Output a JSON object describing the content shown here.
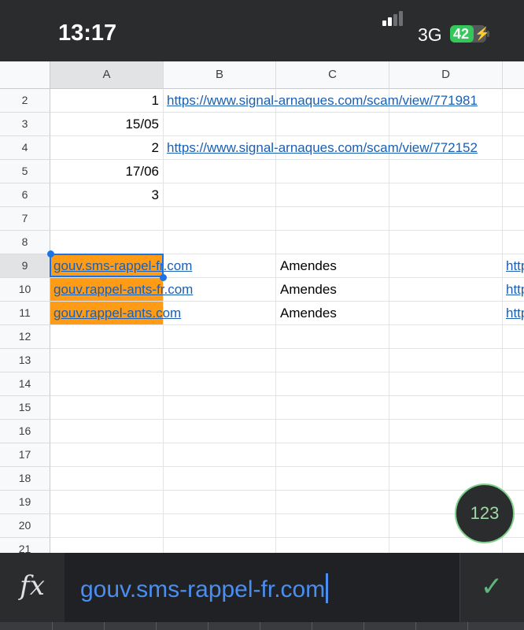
{
  "status_bar": {
    "time": "13:17",
    "network": "3G",
    "battery": "42",
    "battery_level": 0.42
  },
  "columns": [
    "A",
    "B",
    "C",
    "D"
  ],
  "rows": [
    "2",
    "3",
    "4",
    "5",
    "6",
    "7",
    "8",
    "9",
    "10",
    "11",
    "12",
    "13",
    "14",
    "15",
    "16",
    "17",
    "18",
    "19",
    "20",
    "21"
  ],
  "cells": {
    "a2": "1",
    "b2": "https://www.signal-arnaques.com/scam/view/771981",
    "a3": "15/05",
    "a4": "2",
    "b4": "https://www.signal-arnaques.com/scam/view/772152",
    "a5": "17/06",
    "a6": "3",
    "a9": "gouv.sms-rappel-fr.com",
    "c9": "Amendes",
    "e9": "http",
    "a10": "gouv.rappel-ants-fr.com",
    "c10": "Amendes",
    "e10": "http",
    "a11": "gouv.rappel-ants.com",
    "c11": "Amendes",
    "e11": "http"
  },
  "keyboard_toggle": "123",
  "formula_bar": {
    "fx_label": "fx",
    "value": "gouv.sms-rappel-fr.com",
    "confirm": "✓"
  },
  "colors": {
    "highlight": "#ff9b14",
    "link": "#1a5fb4",
    "selection": "#1a73e8"
  }
}
